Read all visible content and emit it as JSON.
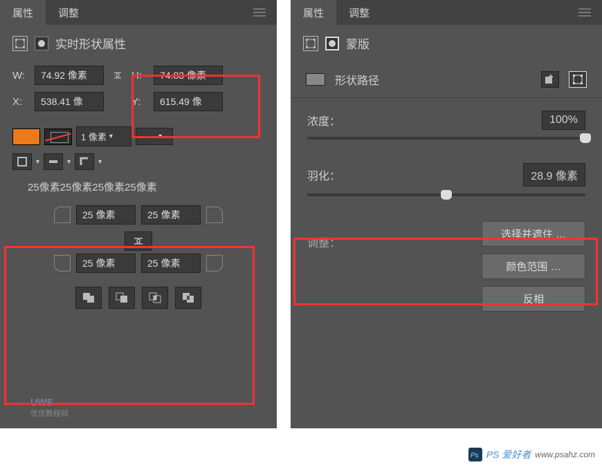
{
  "tabs": {
    "properties": "属性",
    "adjustments": "调整"
  },
  "left": {
    "title": "实时形状属性",
    "W_label": "W:",
    "W_value": "74.92 像素",
    "H_label": "H:",
    "H_value": "74.83 像素",
    "X_label": "X:",
    "X_value": "538.41 像",
    "Y_label": "Y:",
    "Y_value": "615.49 像",
    "stroke_width": "1 像素",
    "stroke_style": "—",
    "corner_summary": "25像素25像素25像素25像素",
    "corner_tl": "25 像素",
    "corner_tr": "25 像素",
    "corner_bl": "25 像素",
    "corner_br": "25 像素"
  },
  "right": {
    "title": "蒙版",
    "subtype": "形状路径",
    "density_label": "浓度：",
    "density_value": "100%",
    "feather_label": "羽化：",
    "feather_value": "28.9 像素",
    "refine_label": "调整：",
    "btn_select_mask": "选择并遮住 …",
    "btn_color_range": "颜色范围 …",
    "btn_invert": "反相"
  },
  "watermarks": {
    "left_brand": "UWS",
    "left_sub": "优优教程网",
    "right_brand": "PS 爱好者",
    "right_url": "www.psahz.com"
  }
}
